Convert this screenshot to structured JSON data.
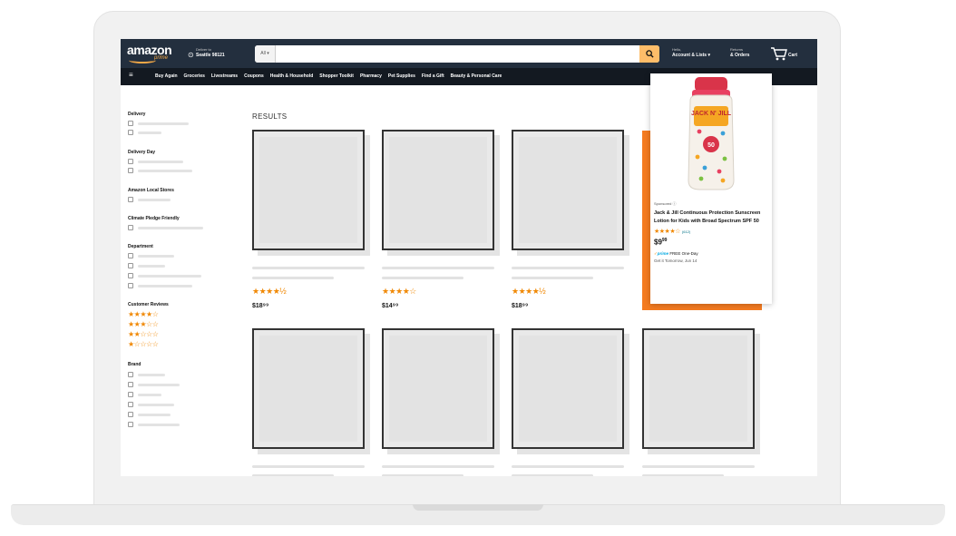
{
  "header": {
    "logo": {
      "word": "amazon",
      "sub": "prime"
    },
    "deliver": {
      "line1": "Deliver to",
      "line2": "Seattle 98121"
    },
    "search": {
      "department": "All ▾",
      "placeholder": ""
    },
    "account": {
      "line1": "Hello,",
      "line2": "Account & Lists ▾"
    },
    "orders": {
      "line1": "Returns",
      "line2": "& Orders"
    },
    "cart": {
      "label": "Cart"
    }
  },
  "nav": {
    "menu_icon": "≡",
    "links": [
      "Buy Again",
      "Groceries",
      "Livestreams",
      "Coupons",
      "Health & Household",
      "Shopper Toolkit",
      "Pharmacy",
      "Pet Supplies",
      "Find a Gift",
      "Beauty & Personal Care"
    ]
  },
  "filters": {
    "groups": [
      {
        "title": "Delivery"
      },
      {
        "title": "Delivery Day"
      },
      {
        "title": "Amazon Local Stores"
      },
      {
        "title": "Climate Pledge Friendly"
      },
      {
        "title": "Department"
      },
      {
        "title": "Customer Reviews",
        "star_rows": [
          "★★★★☆",
          "★★★☆☆",
          "★★☆☆☆",
          "★☆☆☆☆"
        ]
      },
      {
        "title": "Brand"
      }
    ]
  },
  "results": {
    "label": "RESULTS",
    "row1": [
      {
        "stars": "★★★★½",
        "rating": 4.5,
        "price": "$18⁹⁹"
      },
      {
        "stars": "★★★★☆",
        "rating": 4.0,
        "price": "$14⁹⁹"
      },
      {
        "stars": "★★★★½",
        "rating": 4.5,
        "price": "$18⁹⁹"
      }
    ]
  },
  "popup": {
    "sponsored": "Sponsored ⓘ",
    "title": "Jack & Jill Continuous Protection Sunscreen Lotion for Kids with Broad Spectrum SPF 50",
    "stars": "★★★★☆",
    "rating": 4.0,
    "review_count": "(612)",
    "price_dollars": "$9",
    "price_cents": "99",
    "prime_word": "prime",
    "delivery": "FREE One-Day",
    "date": "Get it Tomorrow, Jun 14",
    "bottle_label": "JACK N' JILL",
    "bottle_spf": "50"
  },
  "colors": {
    "topbar": "#232f3e",
    "navbar": "#131921",
    "search_button": "#febd69",
    "highlight": "#f47b20",
    "star": "#f08804"
  }
}
